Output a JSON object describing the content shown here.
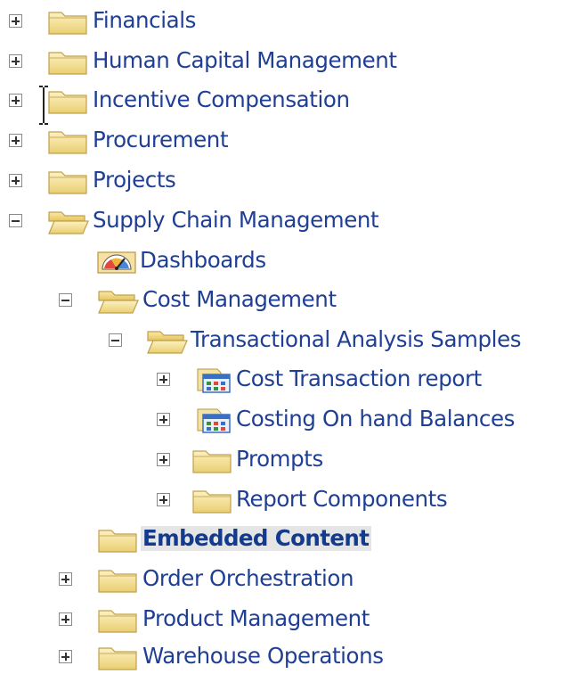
{
  "tree": {
    "items": [
      {
        "label": "Financials",
        "toggle": "plus",
        "icon": "folder-icon"
      },
      {
        "label": "Human Capital Management",
        "toggle": "plus",
        "icon": "folder-icon"
      },
      {
        "label": "Incentive Compensation",
        "toggle": "plus",
        "icon": "folder-icon"
      },
      {
        "label": "Procurement",
        "toggle": "plus",
        "icon": "folder-icon"
      },
      {
        "label": "Projects",
        "toggle": "plus",
        "icon": "folder-icon"
      },
      {
        "label": "Supply Chain Management",
        "toggle": "minus",
        "icon": "folder-open-icon"
      },
      {
        "label": "Dashboards",
        "toggle": "none",
        "icon": "dashboard-icon"
      },
      {
        "label": "Cost Management",
        "toggle": "minus",
        "icon": "folder-open-icon"
      },
      {
        "label": "Transactional Analysis Samples",
        "toggle": "minus",
        "icon": "folder-open-icon"
      },
      {
        "label": "Cost Transaction report",
        "toggle": "plus",
        "icon": "analysis-icon"
      },
      {
        "label": "Costing On hand Balances",
        "toggle": "plus",
        "icon": "analysis-icon"
      },
      {
        "label": "Prompts",
        "toggle": "plus",
        "icon": "folder-icon"
      },
      {
        "label": "Report Components",
        "toggle": "plus",
        "icon": "folder-icon"
      },
      {
        "label": "Embedded Content",
        "toggle": "none",
        "icon": "folder-icon",
        "selected": true
      },
      {
        "label": "Order Orchestration",
        "toggle": "plus",
        "icon": "folder-icon"
      },
      {
        "label": "Product Management",
        "toggle": "plus",
        "icon": "folder-icon"
      },
      {
        "label": "Warehouse Operations",
        "toggle": "plus",
        "icon": "folder-icon"
      }
    ]
  },
  "colors": {
    "link": "#1f3f95",
    "folder": "#f2dc8a",
    "selected_bg": "#e5e5e5"
  }
}
